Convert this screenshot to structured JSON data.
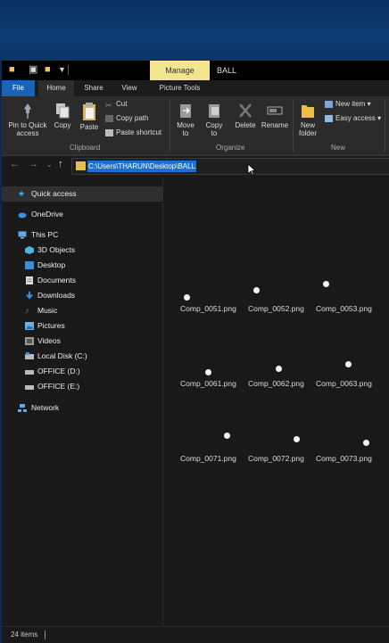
{
  "window": {
    "title": "BALL",
    "context_tab": "Manage"
  },
  "tabs": [
    "File",
    "Home",
    "Share",
    "View",
    "Picture Tools"
  ],
  "ribbon": {
    "clipboard": {
      "pin_label_1": "Pin to Quick",
      "pin_label_2": "access",
      "copy": "Copy",
      "paste": "Paste",
      "cut": "Cut",
      "copy_path": "Copy path",
      "paste_shortcut": "Paste shortcut",
      "group": "Clipboard"
    },
    "organize": {
      "move_to_1": "Move",
      "move_to_2": "to",
      "copy_to_1": "Copy",
      "copy_to_2": "to",
      "delete": "Delete",
      "rename": "Rename",
      "group": "Organize"
    },
    "new": {
      "new_folder_1": "New",
      "new_folder_2": "folder",
      "new_item": "New item",
      "easy_access": "Easy access",
      "group": "New"
    }
  },
  "address": {
    "path": "C:\\Users\\THARUN\\Desktop\\BALL"
  },
  "nav": {
    "items": [
      {
        "label": "Quick access",
        "icon": "star-icon"
      },
      {
        "label": "OneDrive",
        "icon": "cloud-icon"
      },
      {
        "label": "This PC",
        "icon": "computer-icon"
      },
      {
        "label": "3D Objects",
        "icon": "cube-icon"
      },
      {
        "label": "Desktop",
        "icon": "desktop-icon"
      },
      {
        "label": "Documents",
        "icon": "document-icon"
      },
      {
        "label": "Downloads",
        "icon": "download-icon"
      },
      {
        "label": "Music",
        "icon": "music-icon"
      },
      {
        "label": "Pictures",
        "icon": "pictures-icon"
      },
      {
        "label": "Videos",
        "icon": "video-icon"
      },
      {
        "label": "Local Disk (C:)",
        "icon": "disk-icon"
      },
      {
        "label": "OFFICE (D:)",
        "icon": "drive-icon"
      },
      {
        "label": "OFFICE (E:)",
        "icon": "drive-icon"
      },
      {
        "label": "Network",
        "icon": "network-icon"
      }
    ]
  },
  "files": [
    {
      "name": "Comp_0051.png"
    },
    {
      "name": "Comp_0052.png"
    },
    {
      "name": "Comp_0053.png"
    },
    {
      "name": "Comp_0061.png"
    },
    {
      "name": "Comp_0062.png"
    },
    {
      "name": "Comp_0063.png"
    },
    {
      "name": "Comp_0071.png"
    },
    {
      "name": "Comp_0072.png"
    },
    {
      "name": "Comp_0073.png"
    }
  ],
  "status": {
    "count": "24 items"
  },
  "colors": {
    "file_tab": "#1a64b8",
    "manage_tab": "#f3e48f",
    "folder": "#e9bf4a",
    "selection": "#1a6fd1"
  }
}
